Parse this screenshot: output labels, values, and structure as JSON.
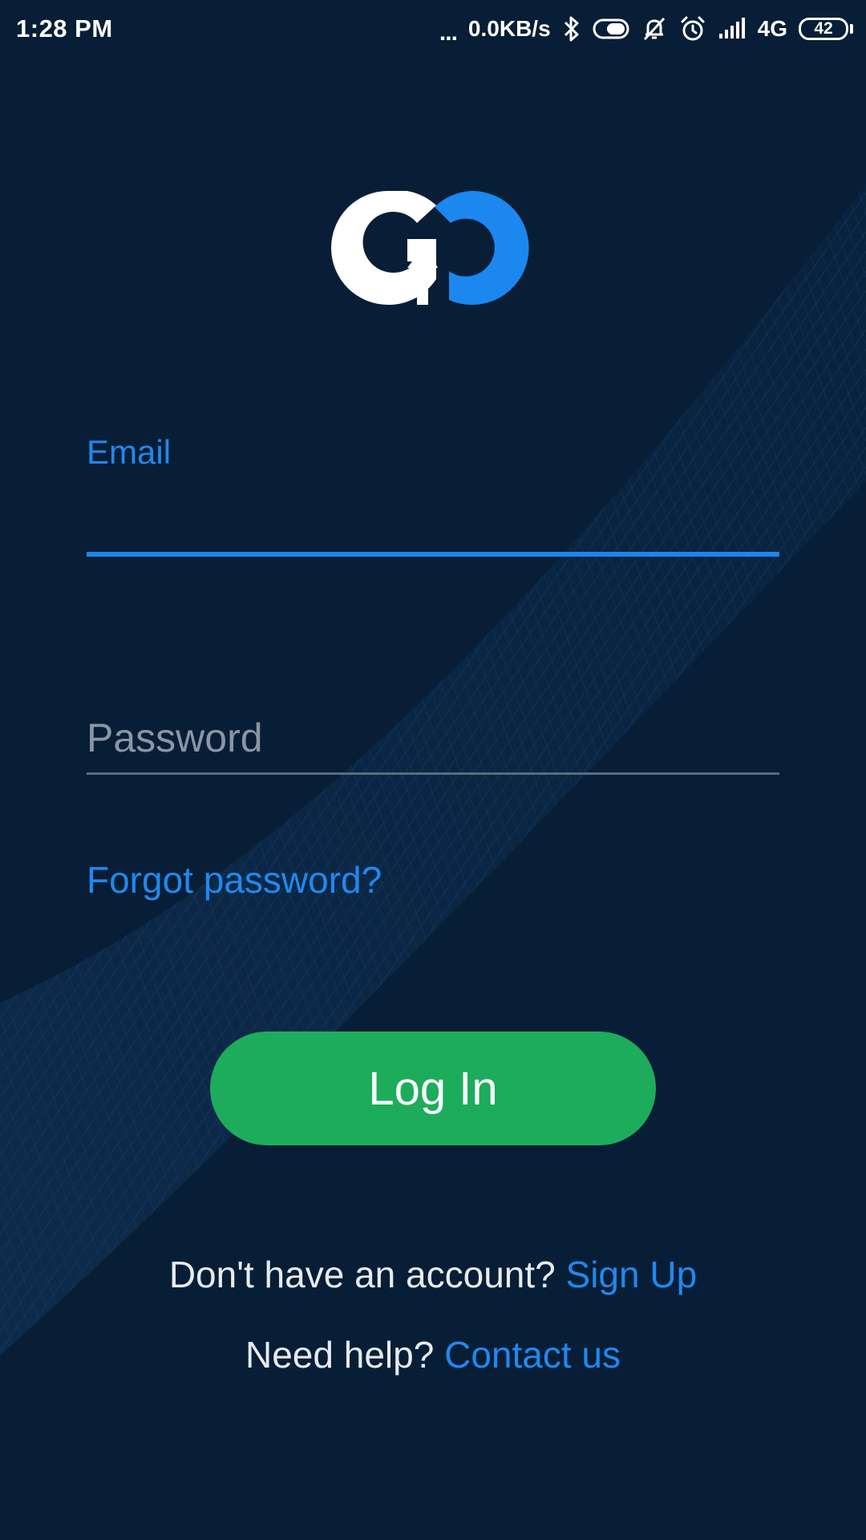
{
  "status_bar": {
    "time": "1:28 PM",
    "more_indicator": "...",
    "data_speed": "0.0KB/s",
    "network": "4G",
    "battery_level": "42",
    "icons": [
      "bluetooth-icon",
      "toggle-icon",
      "mute-icon",
      "alarm-icon",
      "signal-icon",
      "battery-icon"
    ]
  },
  "logo": {
    "name": "go-logo",
    "colors": {
      "left": "#ffffff",
      "right": "#1b87ef"
    }
  },
  "form": {
    "email_label": "Email",
    "email_value": "",
    "password_placeholder": "Password",
    "password_value": "",
    "forgot_label": "Forgot password?"
  },
  "login_button": {
    "label": "Log In"
  },
  "footer": {
    "signup_prompt": "Don't have an account?",
    "signup_link": "Sign Up",
    "help_prompt": "Need help?",
    "help_link": "Contact us"
  },
  "colors": {
    "background": "#071e36",
    "accent": "#2088ee",
    "button": "#1dac5b"
  }
}
